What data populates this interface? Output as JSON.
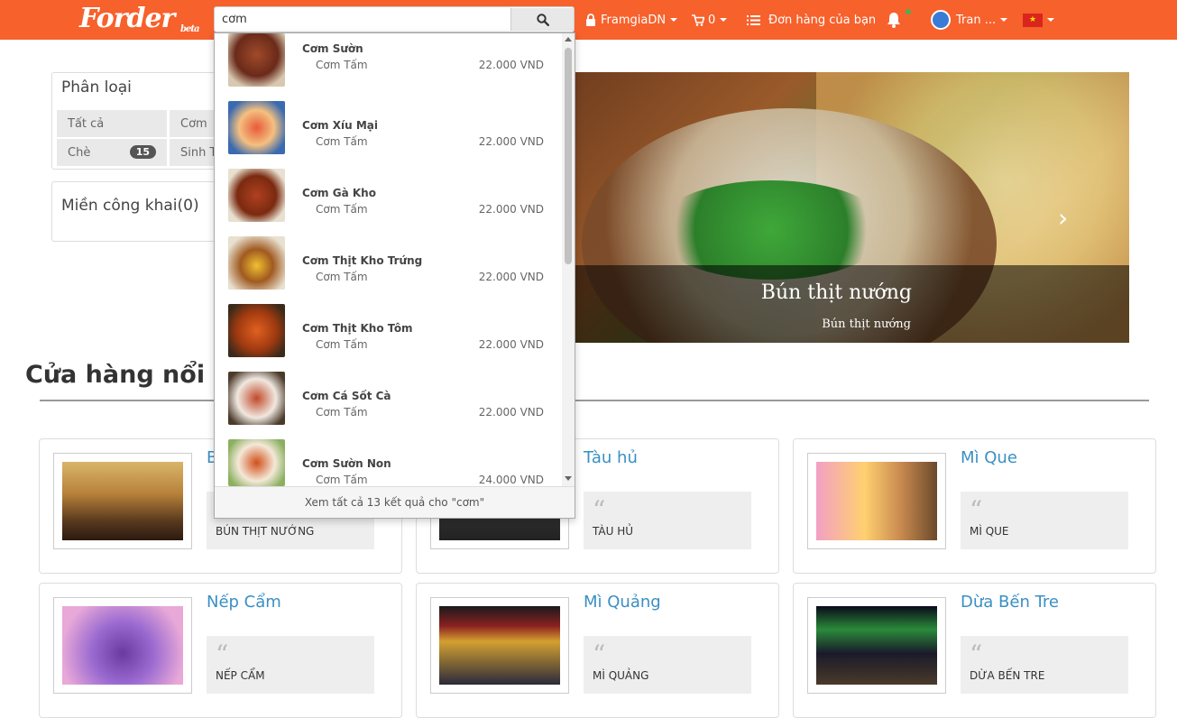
{
  "navbar": {
    "logo": "Forder",
    "logo_tag": "beta",
    "search": {
      "value": "cơm",
      "placeholder": ""
    },
    "account_label": "FramgiaDN",
    "cart_count": "0",
    "orders_label": "Đơn hàng của bạn",
    "user_label": "Tran ...",
    "colors": {
      "primary": "#f7612c"
    },
    "icons": [
      "lock-icon",
      "cart-icon",
      "list-icon",
      "bell-icon",
      "avatar",
      "vietnam-flag-icon"
    ]
  },
  "sidebar": {
    "category_title": "Phân loại",
    "categories": [
      {
        "label": "Tất cả",
        "count": ""
      },
      {
        "label": "Cơm",
        "count": ""
      },
      {
        "label": "Chè",
        "count": "15"
      },
      {
        "label": "Sinh T",
        "count": ""
      }
    ],
    "region_title": "Miền công khai(0)"
  },
  "slider": {
    "title": "Bún thịt nướng",
    "subtitle": "Bún thịt nướng"
  },
  "featured": {
    "title": "Cửa hàng nổi bật",
    "shops": [
      {
        "name": "B",
        "quote": "BÚN THỊT NƯỚNG"
      },
      {
        "name": "Tàu hủ",
        "quote": "TÀU HỦ"
      },
      {
        "name": "Mì Que",
        "quote": "MÌ QUE"
      },
      {
        "name": "Nếp Cẩm",
        "quote": "NẾP CẨM"
      },
      {
        "name": "Mì Quảng",
        "quote": "MÌ QUẢNG"
      },
      {
        "name": "Dừa Bến Tre",
        "quote": "DỪA BẾN TRE"
      }
    ]
  },
  "search_results": {
    "items": [
      {
        "name": "Cơm Sườn",
        "shop": "Cơm Tấm",
        "price": "22.000 VND"
      },
      {
        "name": "Cơm Xíu Mại",
        "shop": "Cơm Tấm",
        "price": "22.000 VND"
      },
      {
        "name": "Cơm Gà Kho",
        "shop": "Cơm Tấm",
        "price": "22.000 VND"
      },
      {
        "name": "Cơm Thịt Kho Trứng",
        "shop": "Cơm Tấm",
        "price": "22.000 VND"
      },
      {
        "name": "Cơm Thịt Kho Tôm",
        "shop": "Cơm Tấm",
        "price": "22.000 VND"
      },
      {
        "name": "Cơm Cá Sốt Cà",
        "shop": "Cơm Tấm",
        "price": "22.000 VND"
      },
      {
        "name": "Cơm Sườn Non",
        "shop": "Cơm Tấm",
        "price": "24.000 VND"
      }
    ],
    "see_all": "Xem tất cả 13 kết quả cho \"cơm\""
  }
}
